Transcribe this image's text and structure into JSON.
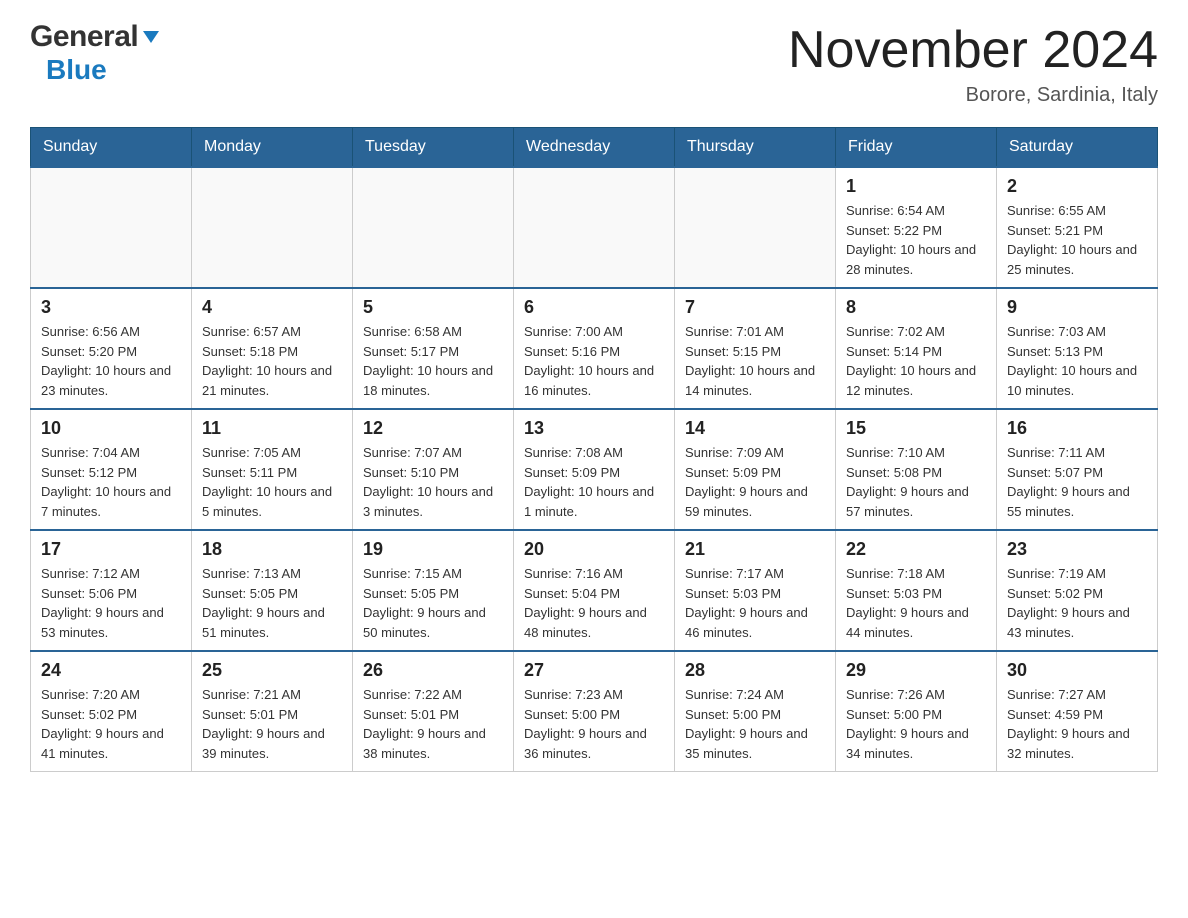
{
  "header": {
    "logo_general": "General",
    "logo_blue": "Blue",
    "month_title": "November 2024",
    "location": "Borore, Sardinia, Italy"
  },
  "days_of_week": [
    "Sunday",
    "Monday",
    "Tuesday",
    "Wednesday",
    "Thursday",
    "Friday",
    "Saturday"
  ],
  "weeks": [
    [
      {
        "day": "",
        "info": ""
      },
      {
        "day": "",
        "info": ""
      },
      {
        "day": "",
        "info": ""
      },
      {
        "day": "",
        "info": ""
      },
      {
        "day": "",
        "info": ""
      },
      {
        "day": "1",
        "info": "Sunrise: 6:54 AM\nSunset: 5:22 PM\nDaylight: 10 hours and 28 minutes."
      },
      {
        "day": "2",
        "info": "Sunrise: 6:55 AM\nSunset: 5:21 PM\nDaylight: 10 hours and 25 minutes."
      }
    ],
    [
      {
        "day": "3",
        "info": "Sunrise: 6:56 AM\nSunset: 5:20 PM\nDaylight: 10 hours and 23 minutes."
      },
      {
        "day": "4",
        "info": "Sunrise: 6:57 AM\nSunset: 5:18 PM\nDaylight: 10 hours and 21 minutes."
      },
      {
        "day": "5",
        "info": "Sunrise: 6:58 AM\nSunset: 5:17 PM\nDaylight: 10 hours and 18 minutes."
      },
      {
        "day": "6",
        "info": "Sunrise: 7:00 AM\nSunset: 5:16 PM\nDaylight: 10 hours and 16 minutes."
      },
      {
        "day": "7",
        "info": "Sunrise: 7:01 AM\nSunset: 5:15 PM\nDaylight: 10 hours and 14 minutes."
      },
      {
        "day": "8",
        "info": "Sunrise: 7:02 AM\nSunset: 5:14 PM\nDaylight: 10 hours and 12 minutes."
      },
      {
        "day": "9",
        "info": "Sunrise: 7:03 AM\nSunset: 5:13 PM\nDaylight: 10 hours and 10 minutes."
      }
    ],
    [
      {
        "day": "10",
        "info": "Sunrise: 7:04 AM\nSunset: 5:12 PM\nDaylight: 10 hours and 7 minutes."
      },
      {
        "day": "11",
        "info": "Sunrise: 7:05 AM\nSunset: 5:11 PM\nDaylight: 10 hours and 5 minutes."
      },
      {
        "day": "12",
        "info": "Sunrise: 7:07 AM\nSunset: 5:10 PM\nDaylight: 10 hours and 3 minutes."
      },
      {
        "day": "13",
        "info": "Sunrise: 7:08 AM\nSunset: 5:09 PM\nDaylight: 10 hours and 1 minute."
      },
      {
        "day": "14",
        "info": "Sunrise: 7:09 AM\nSunset: 5:09 PM\nDaylight: 9 hours and 59 minutes."
      },
      {
        "day": "15",
        "info": "Sunrise: 7:10 AM\nSunset: 5:08 PM\nDaylight: 9 hours and 57 minutes."
      },
      {
        "day": "16",
        "info": "Sunrise: 7:11 AM\nSunset: 5:07 PM\nDaylight: 9 hours and 55 minutes."
      }
    ],
    [
      {
        "day": "17",
        "info": "Sunrise: 7:12 AM\nSunset: 5:06 PM\nDaylight: 9 hours and 53 minutes."
      },
      {
        "day": "18",
        "info": "Sunrise: 7:13 AM\nSunset: 5:05 PM\nDaylight: 9 hours and 51 minutes."
      },
      {
        "day": "19",
        "info": "Sunrise: 7:15 AM\nSunset: 5:05 PM\nDaylight: 9 hours and 50 minutes."
      },
      {
        "day": "20",
        "info": "Sunrise: 7:16 AM\nSunset: 5:04 PM\nDaylight: 9 hours and 48 minutes."
      },
      {
        "day": "21",
        "info": "Sunrise: 7:17 AM\nSunset: 5:03 PM\nDaylight: 9 hours and 46 minutes."
      },
      {
        "day": "22",
        "info": "Sunrise: 7:18 AM\nSunset: 5:03 PM\nDaylight: 9 hours and 44 minutes."
      },
      {
        "day": "23",
        "info": "Sunrise: 7:19 AM\nSunset: 5:02 PM\nDaylight: 9 hours and 43 minutes."
      }
    ],
    [
      {
        "day": "24",
        "info": "Sunrise: 7:20 AM\nSunset: 5:02 PM\nDaylight: 9 hours and 41 minutes."
      },
      {
        "day": "25",
        "info": "Sunrise: 7:21 AM\nSunset: 5:01 PM\nDaylight: 9 hours and 39 minutes."
      },
      {
        "day": "26",
        "info": "Sunrise: 7:22 AM\nSunset: 5:01 PM\nDaylight: 9 hours and 38 minutes."
      },
      {
        "day": "27",
        "info": "Sunrise: 7:23 AM\nSunset: 5:00 PM\nDaylight: 9 hours and 36 minutes."
      },
      {
        "day": "28",
        "info": "Sunrise: 7:24 AM\nSunset: 5:00 PM\nDaylight: 9 hours and 35 minutes."
      },
      {
        "day": "29",
        "info": "Sunrise: 7:26 AM\nSunset: 5:00 PM\nDaylight: 9 hours and 34 minutes."
      },
      {
        "day": "30",
        "info": "Sunrise: 7:27 AM\nSunset: 4:59 PM\nDaylight: 9 hours and 32 minutes."
      }
    ]
  ]
}
